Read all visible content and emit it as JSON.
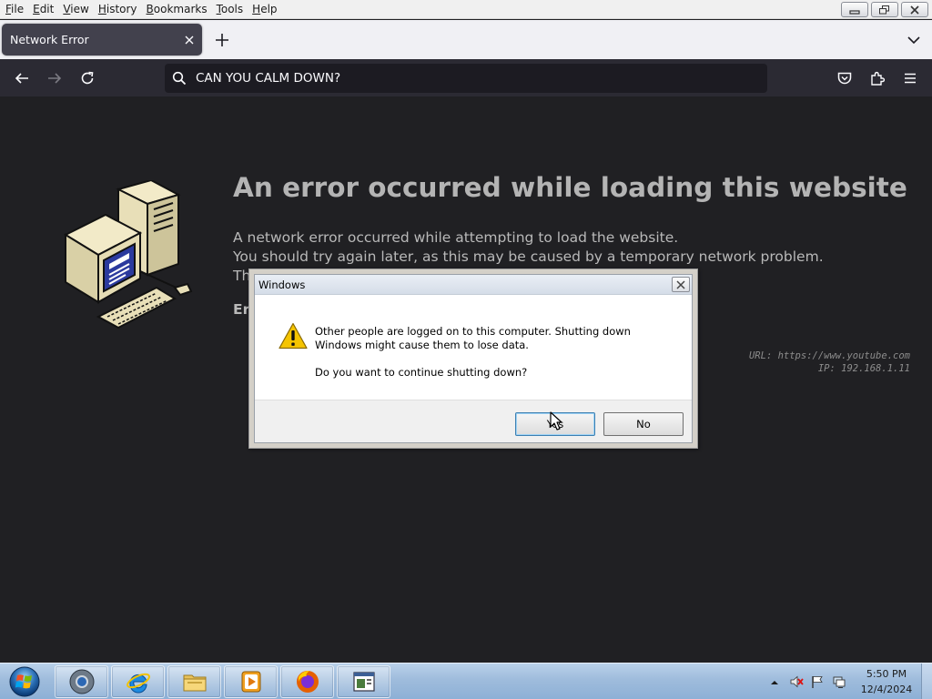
{
  "menubar": {
    "items": [
      "File",
      "Edit",
      "View",
      "History",
      "Bookmarks",
      "Tools",
      "Help"
    ]
  },
  "tab": {
    "title": "Network Error"
  },
  "urlbar": {
    "text": "CAN YOU CALM DOWN?"
  },
  "page": {
    "title": "An error occurred while loading this website",
    "line1": "A network error occurred while attempting to load the website.",
    "line2": "You should try again later, as this may be caused by a temporary network problem.",
    "line3": "Th",
    "error_code": "Er",
    "diag_url": "URL: https://www.youtube.com",
    "diag_ip": "IP: 192.168.1.11"
  },
  "dialog": {
    "title": "Windows",
    "message": "Other people are logged on to this computer. Shutting down Windows might cause them to lose data.",
    "question": "Do you want to continue shutting down?",
    "yes_label": "Yes",
    "no_label": "No"
  },
  "taskbar": {
    "pinned": [
      "chrome-icon",
      "internet-explorer-icon",
      "file-explorer-icon",
      "media-player-icon",
      "firefox-icon",
      "app-window-icon"
    ],
    "clock_time": "5:50 PM",
    "clock_date": "12/4/2024"
  },
  "colors": {
    "page_bg": "#202023",
    "toolbar_bg": "#2b2a33",
    "taskbar": "#9fbcdc"
  }
}
